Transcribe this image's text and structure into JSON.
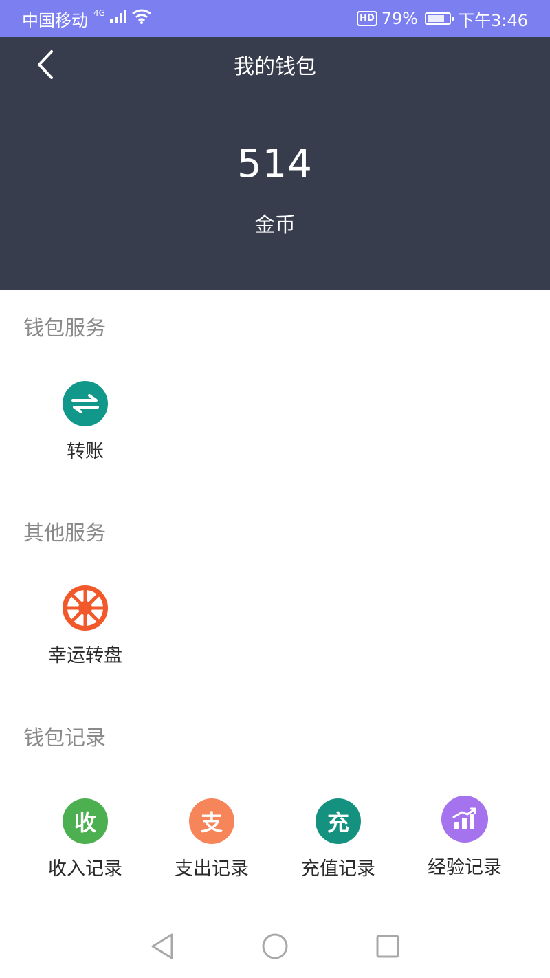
{
  "status_bar": {
    "carrier": "中国移动",
    "network": "4G",
    "hd": "HD",
    "battery": "79%",
    "time": "下午3:46",
    "bg_color": "#7b7ff0"
  },
  "header": {
    "title": "我的钱包",
    "back_icon": "chevron-left-icon",
    "bg_color": "#383d4d"
  },
  "wallet": {
    "balance": "514",
    "unit": "金币"
  },
  "sections": {
    "wallet_services": {
      "title": "钱包服务",
      "items": [
        {
          "label": "转账",
          "icon": "transfer-icon",
          "color": "#12988a"
        }
      ]
    },
    "other_services": {
      "title": "其他服务",
      "items": [
        {
          "label": "幸运转盘",
          "icon": "wheel-icon",
          "color": "#f2592a"
        }
      ]
    },
    "wallet_records": {
      "title": "钱包记录",
      "items": [
        {
          "label": "收入记录",
          "glyph": "收",
          "icon": "income-icon",
          "color": "#4caf50"
        },
        {
          "label": "支出记录",
          "glyph": "支",
          "icon": "expense-icon",
          "color": "#f7855a"
        },
        {
          "label": "充值记录",
          "glyph": "充",
          "icon": "recharge-icon",
          "color": "#14927f"
        },
        {
          "label": "经验记录",
          "icon": "bar-chart-icon",
          "color": "#a673ee"
        }
      ]
    }
  },
  "nav_bar": {
    "back": "triangle-back-icon",
    "home": "circle-home-icon",
    "recents": "square-recents-icon"
  }
}
